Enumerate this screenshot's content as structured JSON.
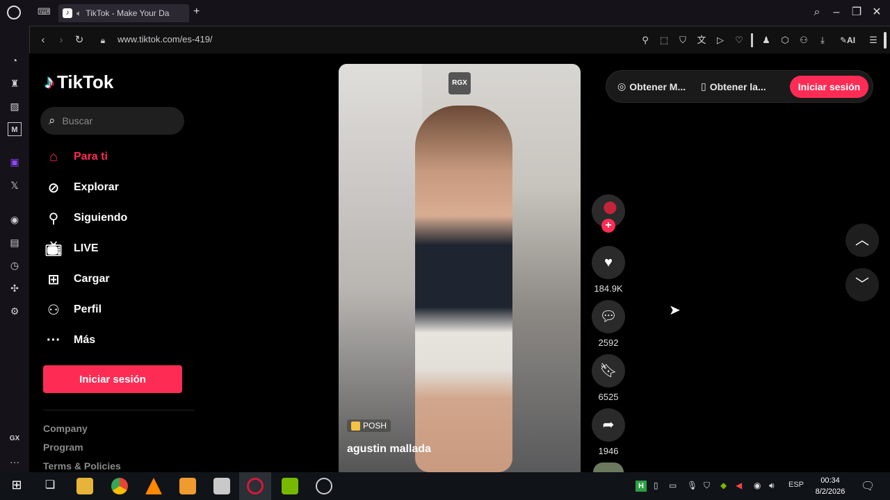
{
  "browser": {
    "tab_title": "TikTok - Make Your Da",
    "new_tab": "+",
    "url": "www.tiktok.com/es-419/",
    "toolbar_ai": "AI"
  },
  "gx_sidebar": {
    "gx_label": "GX",
    "more": "···"
  },
  "tiktok": {
    "logo_text": "TikTok",
    "search_placeholder": "Buscar",
    "nav": [
      {
        "label": "Para ti",
        "icon": "home-icon",
        "active": true
      },
      {
        "label": "Explorar",
        "icon": "compass-icon"
      },
      {
        "label": "Siguiendo",
        "icon": "following-icon"
      },
      {
        "label": "LIVE",
        "icon": "live-tv-icon"
      },
      {
        "label": "Cargar",
        "icon": "upload-icon"
      },
      {
        "label": "Perfil",
        "icon": "profile-icon"
      },
      {
        "label": "Más",
        "icon": "more-icon"
      }
    ],
    "login_button": "Iniciar sesión",
    "footer_links": [
      "Company",
      "Program",
      "Terms & Policies"
    ],
    "top_right": {
      "item1": "Obtener M...",
      "item2": "Obtener la...",
      "login": "Iniciar sesión"
    },
    "video": {
      "watermark": "RGX",
      "tag": "POSH",
      "author": "agustin mallada"
    },
    "actions": {
      "likes": "184.9K",
      "comments": "2592",
      "saves": "6525",
      "shares": "1946"
    }
  },
  "taskbar": {
    "language": "ESP",
    "time": "00:34",
    "date": "8/2/2026"
  },
  "colors": {
    "accent": "#fe2c55",
    "background": "#000000"
  }
}
